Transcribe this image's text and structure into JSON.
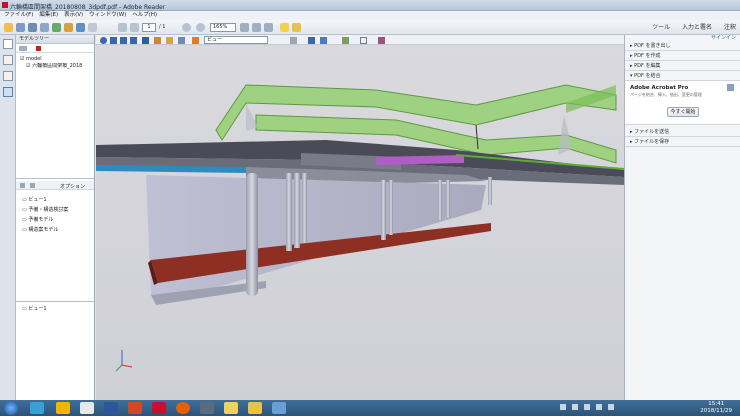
{
  "window": {
    "title": "六輪橋區間架橋_20180808_3dpdf.pdf - Adobe Reader"
  },
  "menu": [
    "ファイル(F)",
    "編集(E)",
    "表示(V)",
    "ウィンドウ(W)",
    "ヘルプ(H)"
  ],
  "toolbar": {
    "page_current": "1",
    "page_total": "/ 1",
    "zoom": "165%"
  },
  "right_links": {
    "tools": "ツール",
    "sign": "入力と署名",
    "comment": "注釈"
  },
  "model_tree": {
    "header": "モデルツリー",
    "root": "model",
    "child": "六輪橋區間架橋_2018"
  },
  "views": {
    "options_label": "オプション",
    "items": [
      "ビュー1",
      "予備・構造検討案",
      "予備モデル",
      "構造案モデル"
    ],
    "footer_item": "ビュー1"
  },
  "view_toolbar": {
    "view_select": "ビュー"
  },
  "right_panel": {
    "signin": "サインイン",
    "sections": [
      "PDF を書き出し",
      "PDF を作成",
      "PDF を編集",
      "PDF を結合"
    ],
    "acrobat_title": "Adobe Acrobat Pro",
    "acrobat_desc": "ページを結合、挿入、抽出、変更の管理",
    "acrobat_button": "今すぐ開始",
    "bottom_sections": [
      "ファイルを送信",
      "ファイルを保存"
    ]
  },
  "taskbar": {
    "time": "15:41",
    "date": "2018/11/29"
  },
  "colors": {
    "accent": "#2b6cb0",
    "pdf_red": "#c8102e",
    "green_deck": "#7fbf5a",
    "pier_grey": "#b8b9c6"
  }
}
